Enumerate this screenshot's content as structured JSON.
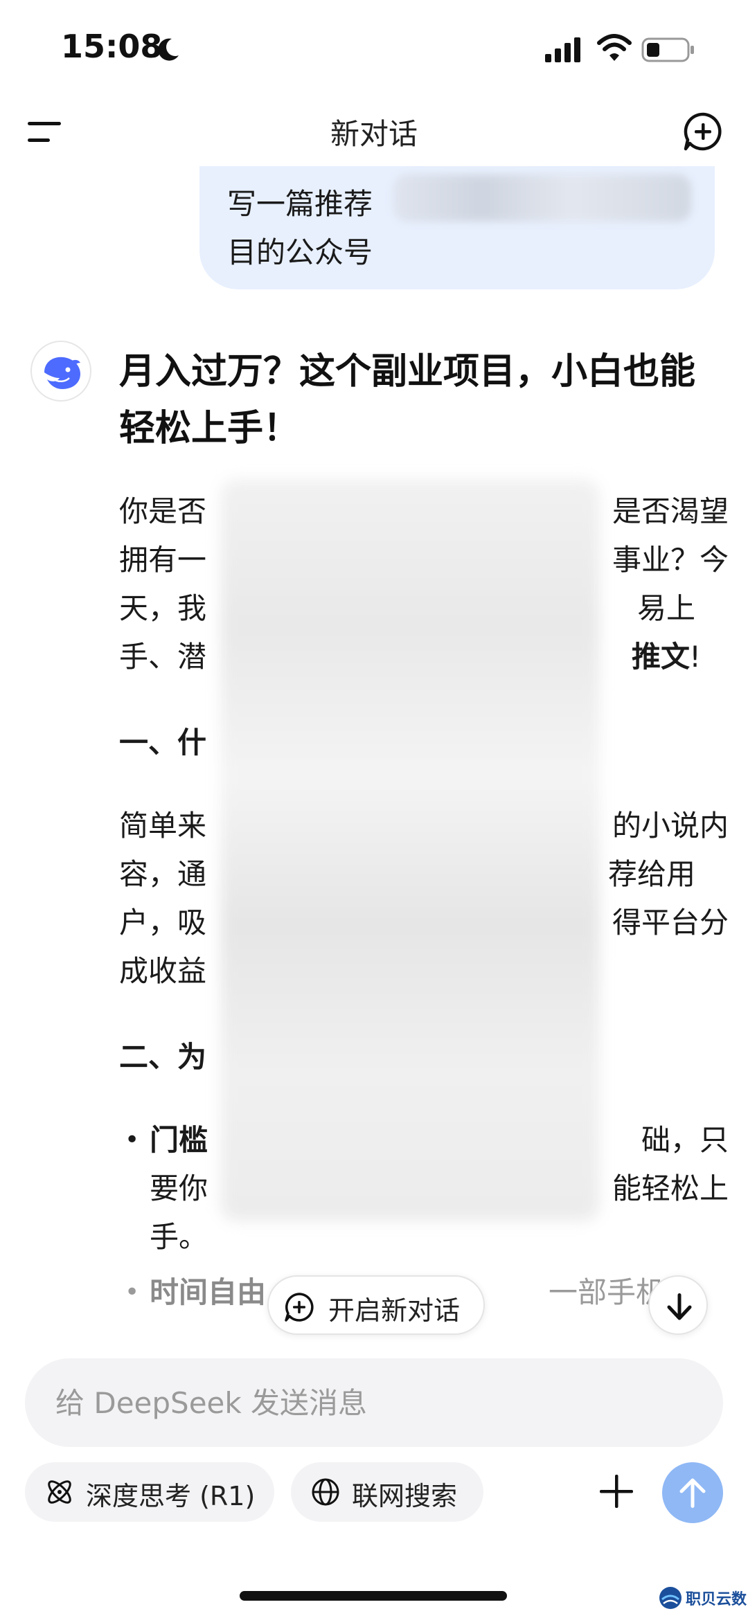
{
  "status_bar": {
    "time": "15:08",
    "icons": [
      "moon-icon",
      "signal-icon",
      "wifi-icon",
      "battery-icon"
    ],
    "battery_level": 0.25
  },
  "header": {
    "title": "新对话",
    "left_icon": "menu-icon",
    "right_icon": "new-chat-icon"
  },
  "user_message": {
    "line1": "写一篇推荐",
    "line2": "目的公众号"
  },
  "assistant": {
    "avatar_icon": "deepseek-whale-icon",
    "article": {
      "title": "月入过万？这个副业项目，小白也能轻松上手！",
      "para1": {
        "l1a": "你是否",
        "l1b": "是否渴望",
        "l2a": "拥有一",
        "l2b": "事业？今",
        "l3a": "天，我",
        "l3b": "易上",
        "l4a": "手、潜",
        "l4b": "推文",
        "l4c": "!"
      },
      "heading1": "一、什",
      "para2": {
        "l1a": "简单来",
        "l1b": "的小说内",
        "l2a": "容，通",
        "l2b": "荐给用",
        "l3a": "户，吸",
        "l3b": "得平台分",
        "l4a": "成收益"
      },
      "heading2": "二、为",
      "bullet1": {
        "bold": "门槛",
        "l1b": "础，只",
        "l2a": "要你",
        "l2b": "能轻松上",
        "l3": "手。"
      },
      "bullet2": {
        "bold": "时间自由",
        "rest": "一部手机，"
      }
    }
  },
  "floating": {
    "start_new_label": "开启新对话",
    "scroll_down_icon": "arrow-down-icon"
  },
  "composer": {
    "placeholder": "给 DeepSeek 发送消息",
    "value": ""
  },
  "toolbar": {
    "deep_think_label": "深度思考 (R1)",
    "web_search_label": "联网搜索",
    "attach_icon": "plus-icon",
    "send_icon": "arrow-up-icon",
    "accent_color": "#8fb8f5"
  },
  "watermark": {
    "text": "职贝云数"
  }
}
